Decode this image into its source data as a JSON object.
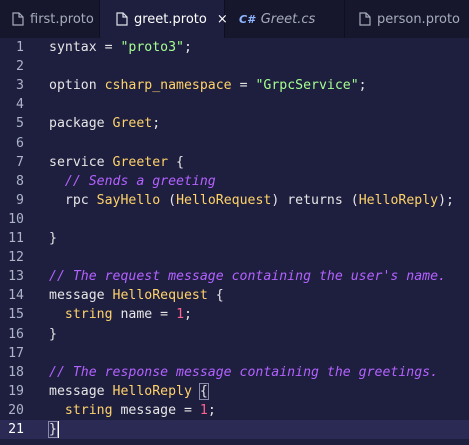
{
  "tabs": [
    {
      "label": "first.proto",
      "active": false,
      "icon": "file-icon"
    },
    {
      "label": "greet.proto",
      "active": true,
      "icon": "file-icon",
      "close": "×"
    },
    {
      "label": "Greet.cs",
      "active": false,
      "icon": "csharp-icon",
      "badge": "C#"
    },
    {
      "label": "person.proto",
      "active": false,
      "icon": "file-icon"
    }
  ],
  "lines": [
    {
      "n": "1",
      "t": [
        [
          "kw",
          "syntax = "
        ],
        [
          "str",
          "\"proto3\""
        ],
        [
          "kw",
          ";"
        ]
      ]
    },
    {
      "n": "2",
      "t": []
    },
    {
      "n": "3",
      "t": [
        [
          "kw",
          "option "
        ],
        [
          "id",
          "csharp_namespace"
        ],
        [
          "kw",
          " = "
        ],
        [
          "str",
          "\"GrpcService\""
        ],
        [
          "kw",
          ";"
        ]
      ]
    },
    {
      "n": "4",
      "t": []
    },
    {
      "n": "5",
      "t": [
        [
          "kw",
          "package "
        ],
        [
          "id",
          "Greet"
        ],
        [
          "kw",
          ";"
        ]
      ]
    },
    {
      "n": "6",
      "t": []
    },
    {
      "n": "7",
      "t": [
        [
          "kw",
          "service "
        ],
        [
          "id",
          "Greeter"
        ],
        [
          "kw",
          " {"
        ]
      ]
    },
    {
      "n": "8",
      "t": [
        [
          "kw",
          "  "
        ],
        [
          "cm",
          "// Sends a greeting"
        ]
      ]
    },
    {
      "n": "9",
      "t": [
        [
          "kw",
          "  rpc "
        ],
        [
          "id",
          "SayHello"
        ],
        [
          "kw",
          " ("
        ],
        [
          "id",
          "HelloRequest"
        ],
        [
          "kw",
          ") returns ("
        ],
        [
          "id",
          "HelloReply"
        ],
        [
          "kw",
          ");"
        ]
      ]
    },
    {
      "n": "10",
      "t": []
    },
    {
      "n": "11",
      "t": [
        [
          "kw",
          "}"
        ]
      ]
    },
    {
      "n": "12",
      "t": []
    },
    {
      "n": "13",
      "t": [
        [
          "cm",
          "// The request message containing the user's name."
        ]
      ]
    },
    {
      "n": "14",
      "t": [
        [
          "kw",
          "message "
        ],
        [
          "id",
          "HelloRequest"
        ],
        [
          "kw",
          " {"
        ]
      ]
    },
    {
      "n": "15",
      "t": [
        [
          "kw",
          "  "
        ],
        [
          "id",
          "string"
        ],
        [
          "kw",
          " name = "
        ],
        [
          "num",
          "1"
        ],
        [
          "kw",
          ";"
        ]
      ]
    },
    {
      "n": "16",
      "t": [
        [
          "kw",
          "}"
        ]
      ]
    },
    {
      "n": "17",
      "t": []
    },
    {
      "n": "18",
      "t": [
        [
          "cm",
          "// The response message containing the greetings."
        ]
      ]
    },
    {
      "n": "19",
      "t": [
        [
          "kw",
          "message "
        ],
        [
          "id",
          "HelloReply"
        ],
        [
          "kw",
          " "
        ],
        [
          "br",
          "{"
        ]
      ]
    },
    {
      "n": "20",
      "t": [
        [
          "kw",
          "  "
        ],
        [
          "id",
          "string"
        ],
        [
          "kw",
          " message = "
        ],
        [
          "num",
          "1"
        ],
        [
          "kw",
          ";"
        ]
      ]
    },
    {
      "n": "21",
      "t": [
        [
          "br",
          "}"
        ]
      ],
      "current": true
    }
  ]
}
